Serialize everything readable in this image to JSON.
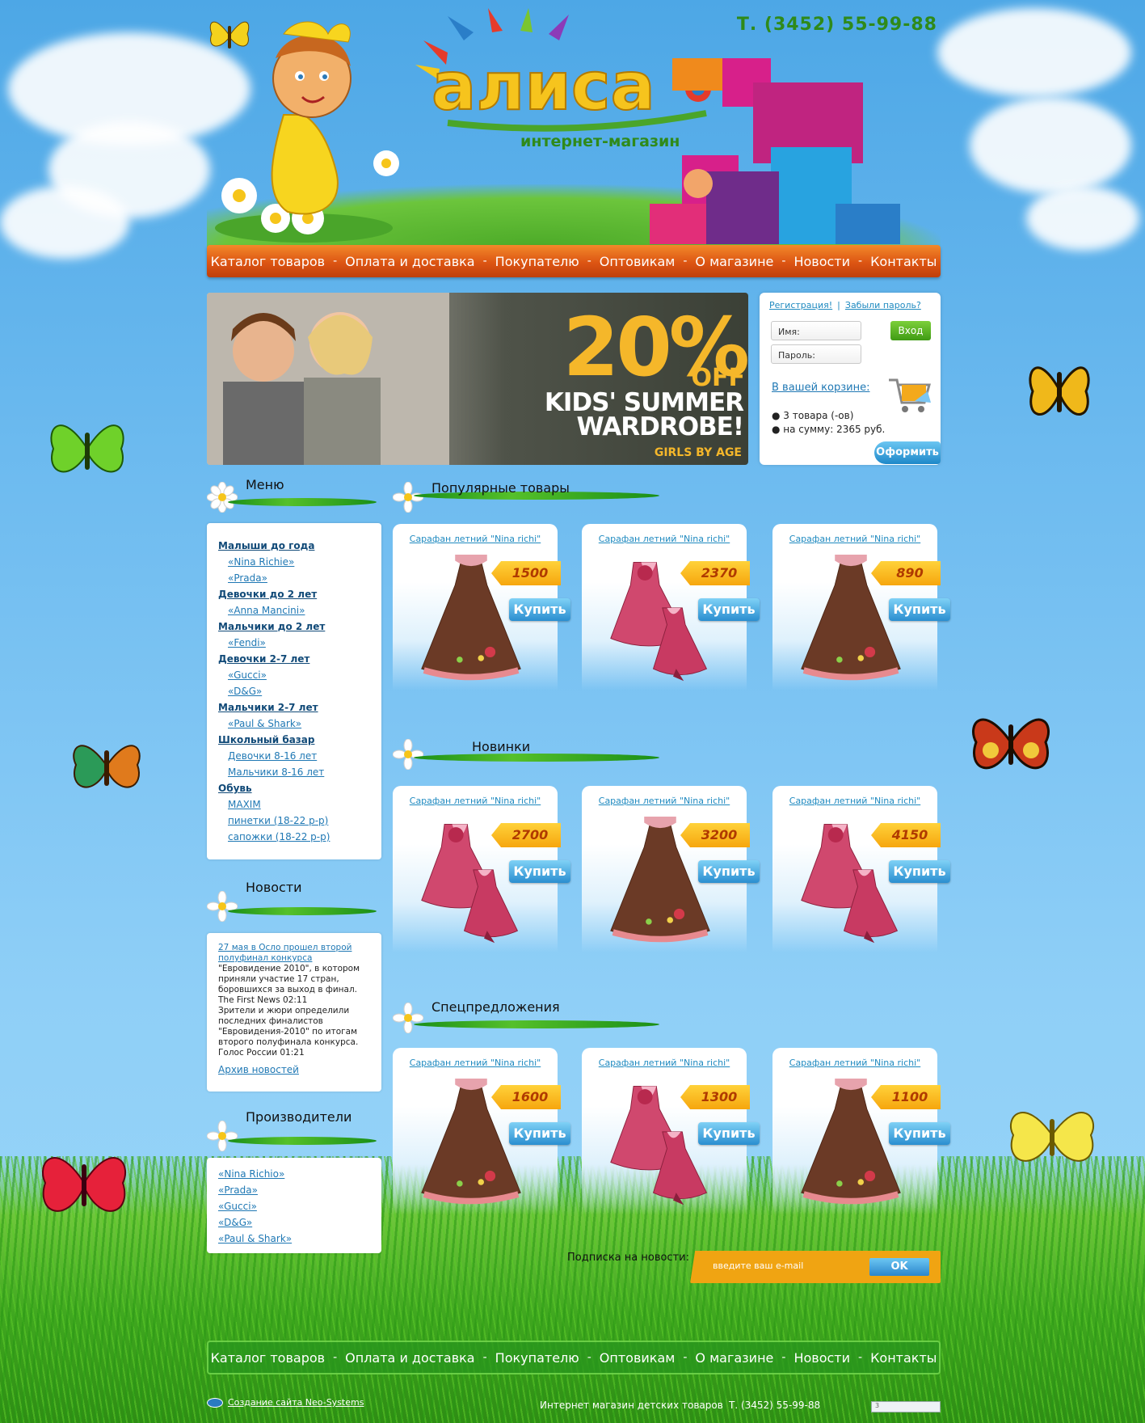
{
  "header": {
    "phone": "Т. (3452) 55-99-88",
    "logo_text": "алиса",
    "logo_subtitle": "интернет-магазин"
  },
  "nav": [
    "Каталог товаров",
    "Оплата и доставка",
    "Покупателю",
    "Оптовикам",
    "О магазине",
    "Новости",
    "Контакты"
  ],
  "nav_separator": "-",
  "banner": {
    "percent": "20%",
    "off": "OFF",
    "line1": "KIDS' SUMMER",
    "line2": "WARDROBE!",
    "tagline": "GIRLS BY AGE"
  },
  "login": {
    "register": "Регистрация!",
    "forgot": "Забыли пароль?",
    "separator": "|",
    "name_placeholder": "Имя:",
    "password_placeholder": "Пароль:",
    "login_button": "Вход",
    "cart_title": "В вашей корзине:",
    "cart_items": "● 3 товара (-ов)",
    "cart_sum": "● на сумму: 2365 руб.",
    "order_button": "Оформить"
  },
  "sidebar": {
    "menu_title": "Меню",
    "menu": [
      {
        "label": "Малыши до года",
        "children": [
          "«Nina Richie»",
          "«Prada»"
        ]
      },
      {
        "label": "Девочки до 2 лет",
        "children": [
          "«Anna Mancini»"
        ]
      },
      {
        "label": "Мальчики до 2 лет",
        "children": [
          "«Fendi»"
        ]
      },
      {
        "label": "Девочки 2-7 лет",
        "children": [
          "«Gucci»",
          "«D&G»"
        ]
      },
      {
        "label": "Мальчики 2-7 лет",
        "children": [
          "«Paul & Shark»"
        ]
      },
      {
        "label": "Школьный базар",
        "children": [
          "Девочки 8-16 лет",
          "Мальчики 8-16 лет"
        ]
      },
      {
        "label": "Обувь",
        "children": [
          "MAXIM",
          "пинетки (18-22 р-р)",
          "сапожки (18-22 р-р)"
        ]
      }
    ],
    "news_title": "Новости",
    "news": {
      "headline": "27 мая в Осло прошел второй полуфинал конкурса",
      "body1": "\"Евровидение 2010\", в котором приняли участие 17 стран, боровшихся за выход в финал.",
      "source1": "The First News  02:11",
      "body2": "Зрители и жюри определили последних финалистов \"Евровидения-2010\" по итогам второго полуфинала конкурса.",
      "source2": "Голос России  01:21",
      "archive": "Архив новостей"
    },
    "brands_title": "Производители",
    "brands": [
      "«Nina Richio»",
      "«Prada»",
      "«Gucci»",
      "«D&G»",
      "«Paul & Shark»"
    ]
  },
  "sections": [
    {
      "title": "Популярные товары",
      "products": [
        {
          "title": "Сарафан летний \"Nina richi\"",
          "price": "1500",
          "buy": "Купить",
          "image": "brown-dress"
        },
        {
          "title": "Сарафан летний \"Nina richi\"",
          "price": "2370",
          "buy": "Купить",
          "image": "pink-dress-set"
        },
        {
          "title": "Сарафан летний \"Nina richi\"",
          "price": "890",
          "buy": "Купить",
          "image": "brown-dress"
        }
      ]
    },
    {
      "title": "Новинки",
      "products": [
        {
          "title": "Сарафан летний \"Nina richi\"",
          "price": "2700",
          "buy": "Купить",
          "image": "pink-dress-set"
        },
        {
          "title": "Сарафан летний \"Nina richi\"",
          "price": "3200",
          "buy": "Купить",
          "image": "brown-dress"
        },
        {
          "title": "Сарафан летний \"Nina richi\"",
          "price": "4150",
          "buy": "Купить",
          "image": "pink-dress-set"
        }
      ]
    },
    {
      "title": "Спецпредложения",
      "products": [
        {
          "title": "Сарафан летний \"Nina richi\"",
          "price": "1600",
          "buy": "Купить",
          "image": "brown-dress"
        },
        {
          "title": "Сарафан летний \"Nina richi\"",
          "price": "1300",
          "buy": "Купить",
          "image": "pink-dress-set"
        },
        {
          "title": "Сарафан летний \"Nina richi\"",
          "price": "1100",
          "buy": "Купить",
          "image": "brown-dress"
        }
      ]
    }
  ],
  "subscribe": {
    "label": "Подписка на новости:",
    "placeholder": "введите ваш e-mail",
    "button": "OK"
  },
  "footer": {
    "nav": [
      "Каталог товаров",
      "Оплата и доставка",
      "Покупателю",
      "Оптовикам",
      "О магазине",
      "Новости",
      "Контакты"
    ],
    "made_by": "Создание сайта Neo-Systems",
    "shop": "Интернет магазин детских товаров",
    "phone": "Т. (3452) 55-99-88",
    "counter": "3"
  },
  "colors": {
    "sky": "#6fbcf0",
    "nav_orange": "#dd5513",
    "link_blue": "#1f8ac0",
    "price_tag": "#f6a60e",
    "buy_blue": "#2a8ed0",
    "green": "#2f8a1a"
  }
}
